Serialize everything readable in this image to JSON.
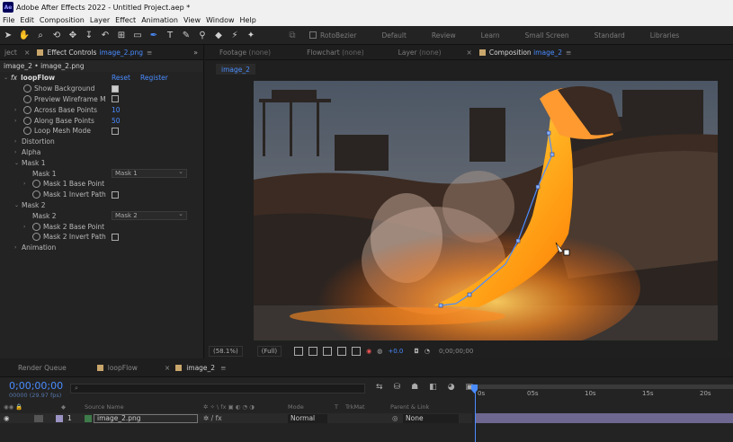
{
  "app": {
    "title": "Adobe After Effects 2022 - Untitled Project.aep *",
    "logo_text": "Ae"
  },
  "menu": [
    "File",
    "Edit",
    "Composition",
    "Layer",
    "Effect",
    "Animation",
    "View",
    "Window",
    "Help"
  ],
  "workspaces": [
    "RotoBezier",
    "Default",
    "Review",
    "Learn",
    "Small Screen",
    "Standard",
    "Libraries"
  ],
  "left_panel": {
    "tab_project": "ject",
    "tab_effect_controls": "Effect Controls",
    "tab_effect_target": "image_2.png",
    "layer_path": "image_2 • image_2.png",
    "effect_name": "loopFlow",
    "reset_label": "Reset",
    "register_label": "Register",
    "props": {
      "show_background": "Show Background",
      "preview_wireframe": "Preview Wireframe M",
      "across_base_points": "Across Base Points",
      "across_base_points_value": "10",
      "along_base_points": "Along Base Points",
      "along_base_points_value": "50",
      "loop_mesh_mode": "Loop Mesh Mode",
      "distortion": "Distortion",
      "alpha": "Alpha",
      "mask1_group": "Mask 1",
      "mask1": "Mask 1",
      "mask1_value": "Mask 1",
      "mask1_base_point": "Mask 1 Base Point",
      "mask1_invert": "Mask 1 Invert Path",
      "mask2_group": "Mask 2",
      "mask2": "Mask 2",
      "mask2_value": "Mask 2",
      "mask2_base_point": "Mask 2 Base Point",
      "mask2_invert": "Mask 2 Invert Path",
      "animation": "Animation"
    }
  },
  "comp_panel": {
    "tab_footage": "Footage",
    "tab_footage_state": "(none)",
    "tab_flowchart": "Flowchart",
    "tab_flowchart_state": "(none)",
    "tab_layer": "Layer",
    "tab_layer_state": "(none)",
    "tab_composition": "Composition",
    "tab_composition_target": "image_2",
    "sub_tab": "image_2",
    "zoom": "(58.1%)",
    "resolution": "(Full)",
    "exposure": "+0.0",
    "time": "0;00;00;00"
  },
  "timeline": {
    "tabs": [
      "Render Queue",
      "loopFlow",
      "image_2"
    ],
    "current_time": "0;00;00;00",
    "fps": "00000 (29.97 fps)",
    "search_placeholder": "",
    "ruler_marks": [
      "0s",
      "05s",
      "10s",
      "15s",
      "20s"
    ],
    "col_source_name": "Source Name",
    "col_mode": "Mode",
    "col_t": "T",
    "col_trkmat": "TrkMat",
    "col_parent": "Parent & Link",
    "layer": {
      "number": "1",
      "name": "image_2.png",
      "mode": "Normal",
      "parent": "None"
    }
  },
  "colors": {
    "accent": "#4a8cff",
    "layer_bar": "#6e6790",
    "label_tan": "#c9a66b"
  }
}
